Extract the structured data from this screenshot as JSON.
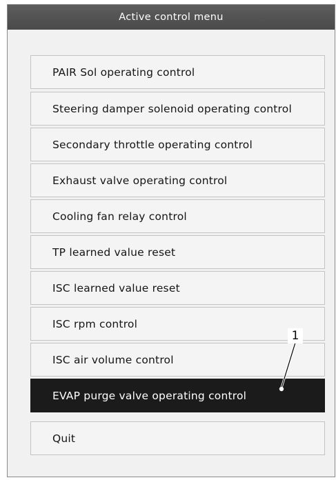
{
  "window": {
    "title": "Active control menu"
  },
  "menu": {
    "items": [
      {
        "label": "PAIR Sol operating control"
      },
      {
        "label": "Steering damper solenoid operating control"
      },
      {
        "label": "Secondary throttle operating control"
      },
      {
        "label": "Exhaust valve operating control"
      },
      {
        "label": "Cooling fan relay control"
      },
      {
        "label": "TP learned value reset"
      },
      {
        "label": "ISC learned value reset"
      },
      {
        "label": "ISC rpm control"
      },
      {
        "label": "ISC air volume control"
      },
      {
        "label": "EVAP purge valve operating control",
        "selected": true
      }
    ],
    "quit_label": "Quit"
  },
  "callout": {
    "label": "1"
  },
  "colors": {
    "titlebar": "#4f4f4f",
    "selected_bg": "#1b1b1b",
    "item_bg": "#f4f4f4"
  }
}
